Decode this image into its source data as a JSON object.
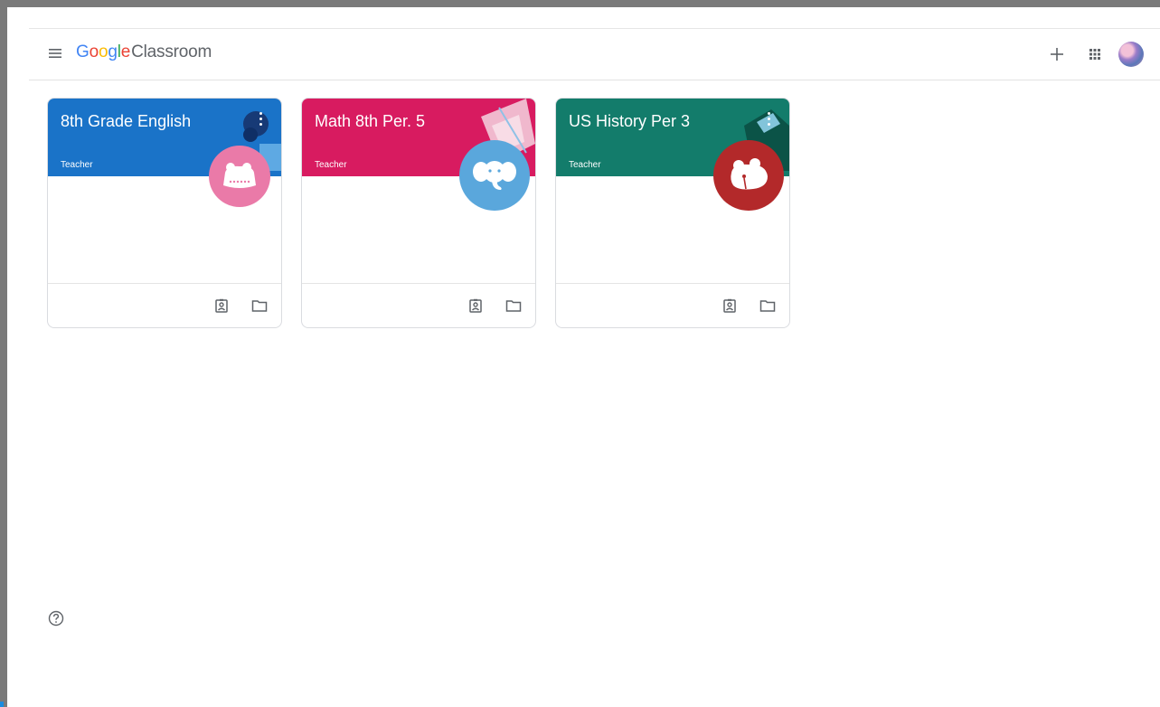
{
  "app": {
    "brand_google": [
      "G",
      "o",
      "o",
      "g",
      "l",
      "e"
    ],
    "brand_product": "Classroom"
  },
  "icons": {
    "menu": "hamburger-icon",
    "add": "plus-icon",
    "apps": "apps-grid-icon",
    "help": "help-circle-icon"
  },
  "classes": [
    {
      "title": "8th Grade English",
      "role": "Teacher",
      "color": "#1a73c8",
      "mascot": "rat",
      "mascot_color": "#ea7aa8"
    },
    {
      "title": "Math 8th Per. 5",
      "role": "Teacher",
      "color": "#d81b60",
      "mascot": "elephant",
      "mascot_color": "#5aa7dc"
    },
    {
      "title": "US History Per 3",
      "role": "Teacher",
      "color": "#137c6b",
      "mascot": "hippo",
      "mascot_color": "#b3292a"
    }
  ]
}
